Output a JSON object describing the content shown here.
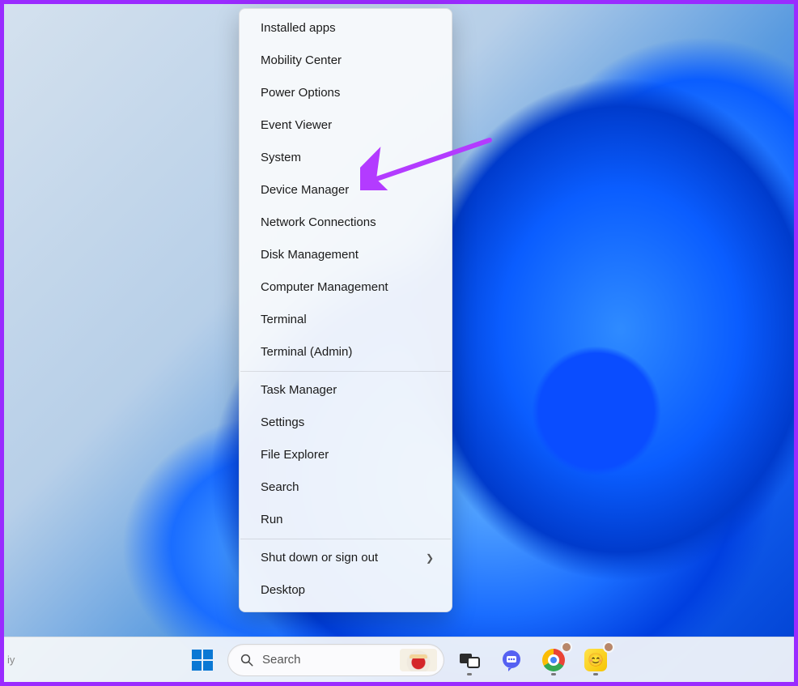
{
  "annotation": {
    "target_label": "Device Manager"
  },
  "context_menu": {
    "groups": [
      [
        "Installed apps",
        "Mobility Center",
        "Power Options",
        "Event Viewer",
        "System",
        "Device Manager",
        "Network Connections",
        "Disk Management",
        "Computer Management",
        "Terminal",
        "Terminal (Admin)"
      ],
      [
        "Task Manager",
        "Settings",
        "File Explorer",
        "Search",
        "Run"
      ],
      [
        {
          "label": "Shut down or sign out",
          "submenu": true
        },
        "Desktop"
      ]
    ]
  },
  "taskbar": {
    "truncated_text": "iy",
    "search_placeholder": "Search",
    "items": [
      {
        "id": "start",
        "name": "start-button"
      },
      {
        "id": "search",
        "name": "search-pill"
      },
      {
        "id": "taskview",
        "name": "task-view-button"
      },
      {
        "id": "chat",
        "name": "chat-button"
      },
      {
        "id": "chrome",
        "name": "chrome-button"
      },
      {
        "id": "yellowapp",
        "name": "app-button"
      }
    ]
  }
}
